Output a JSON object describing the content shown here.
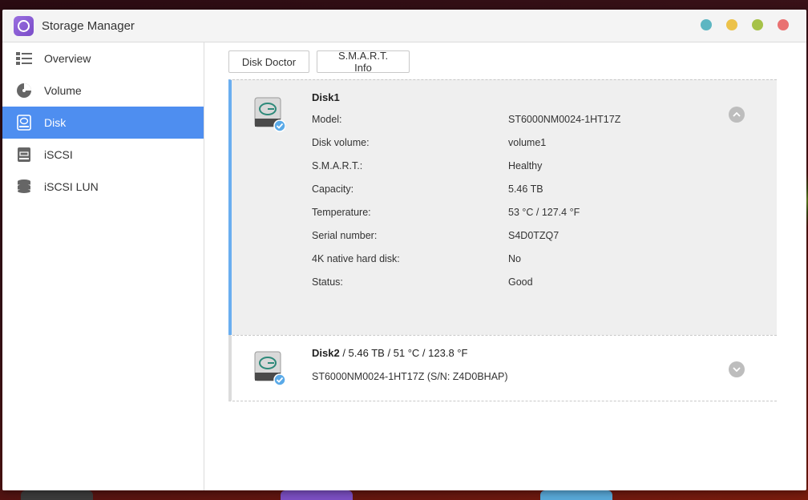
{
  "window": {
    "title": "Storage Manager",
    "app_icon": "storage-manager-app-icon",
    "controls": [
      {
        "name": "window-control-teal",
        "color": "#5db6c2"
      },
      {
        "name": "window-control-yellow",
        "color": "#ecc24a"
      },
      {
        "name": "window-control-green",
        "color": "#a6c248"
      },
      {
        "name": "window-control-close",
        "color": "#e97171"
      }
    ]
  },
  "sidebar": {
    "items": [
      {
        "label": "Overview",
        "icon": "overview-icon",
        "active": false
      },
      {
        "label": "Volume",
        "icon": "volume-icon",
        "active": false
      },
      {
        "label": "Disk",
        "icon": "disk-icon",
        "active": true
      },
      {
        "label": "iSCSI",
        "icon": "iscsi-icon",
        "active": false
      },
      {
        "label": "iSCSI LUN",
        "icon": "iscsi-lun-icon",
        "active": false
      }
    ]
  },
  "toolbar": {
    "disk_doctor": "Disk Doctor",
    "smart_info": "S.M.A.R.T. Info"
  },
  "disks": [
    {
      "name": "Disk1",
      "expanded": true,
      "properties": [
        {
          "label": "Model:",
          "value": "ST6000NM0024-1HT17Z"
        },
        {
          "label": "Disk volume:",
          "value": "volume1"
        },
        {
          "label": "S.M.A.R.T.:",
          "value": "Healthy"
        },
        {
          "label": "Capacity:",
          "value": "5.46 TB"
        },
        {
          "label": "Temperature:",
          "value": "53 °C / 127.4 °F"
        },
        {
          "label": "Serial number:",
          "value": "S4D0TZQ7"
        },
        {
          "label": "4K native hard disk:",
          "value": "No"
        },
        {
          "label": "Status:",
          "value": "Good"
        }
      ]
    },
    {
      "name": "Disk2",
      "expanded": false,
      "header_detail": " / 5.46 TB / 51 °C / 123.8 °F",
      "summary": "ST6000NM0024-1HT17Z (S/N: Z4D0BHAP)"
    }
  ],
  "colors": {
    "accent": "#4e8ef0",
    "expanded_border": "#6aaef0",
    "check_badge": "#5aaae8"
  }
}
